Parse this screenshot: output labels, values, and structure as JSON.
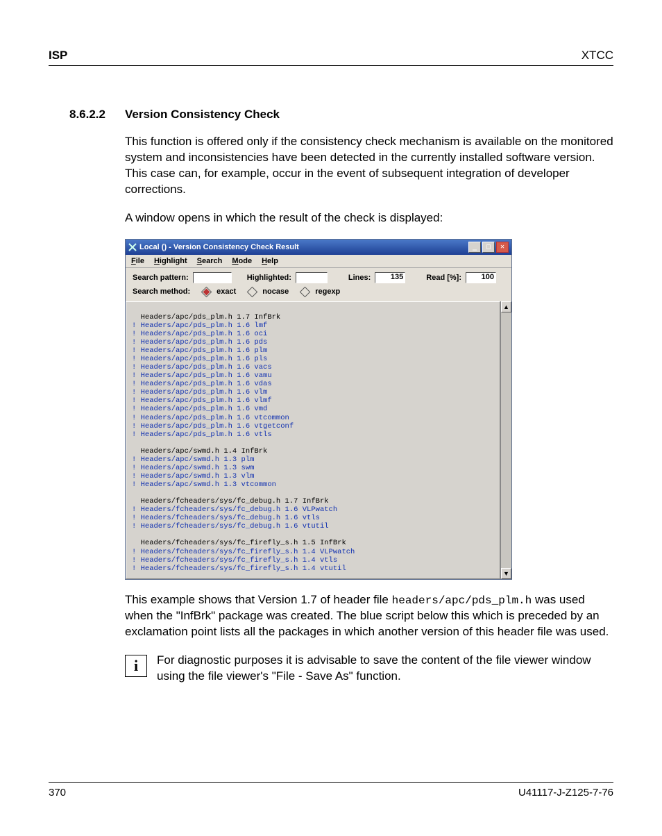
{
  "header": {
    "left": "ISP",
    "right": "XTCC"
  },
  "section": {
    "number": "8.6.2.2",
    "title": "Version Consistency Check"
  },
  "para1": "This function is offered only if the consistency check mechanism is available on the monitored system and inconsistencies have been detected in the currently installed software version. This case can, for example, occur in the event of subsequent integration of developer corrections.",
  "para2": "A window opens in which the result of the check is displayed:",
  "window": {
    "title": "Local () - Version Consistency Check Result",
    "menu": {
      "file": "File",
      "highlight": "Highlight",
      "search": "Search",
      "mode": "Mode",
      "help": "Help"
    },
    "labels": {
      "search_pattern": "Search pattern:",
      "highlighted": "Highlighted:",
      "lines": "Lines:",
      "read": "Read [%]:",
      "search_method": "Search method:",
      "exact": "exact",
      "nocase": "nocase",
      "regexp": "regexp"
    },
    "values": {
      "lines": "135",
      "read": "100"
    },
    "lines": [
      {
        "c": "blk",
        "t": "  Headers/apc/pds_plm.h 1.7 InfBrk"
      },
      {
        "c": "blu",
        "t": "! Headers/apc/pds_plm.h 1.6 lmf"
      },
      {
        "c": "blu",
        "t": "! Headers/apc/pds_plm.h 1.6 oci"
      },
      {
        "c": "blu",
        "t": "! Headers/apc/pds_plm.h 1.6 pds"
      },
      {
        "c": "blu",
        "t": "! Headers/apc/pds_plm.h 1.6 plm"
      },
      {
        "c": "blu",
        "t": "! Headers/apc/pds_plm.h 1.6 pls"
      },
      {
        "c": "blu",
        "t": "! Headers/apc/pds_plm.h 1.6 vacs"
      },
      {
        "c": "blu",
        "t": "! Headers/apc/pds_plm.h 1.6 vamu"
      },
      {
        "c": "blu",
        "t": "! Headers/apc/pds_plm.h 1.6 vdas"
      },
      {
        "c": "blu",
        "t": "! Headers/apc/pds_plm.h 1.6 vlm"
      },
      {
        "c": "blu",
        "t": "! Headers/apc/pds_plm.h 1.6 vlmf"
      },
      {
        "c": "blu",
        "t": "! Headers/apc/pds_plm.h 1.6 vmd"
      },
      {
        "c": "blu",
        "t": "! Headers/apc/pds_plm.h 1.6 vtcommon"
      },
      {
        "c": "blu",
        "t": "! Headers/apc/pds_plm.h 1.6 vtgetconf"
      },
      {
        "c": "blu",
        "t": "! Headers/apc/pds_plm.h 1.6 vtls"
      },
      {
        "c": "blk",
        "t": ""
      },
      {
        "c": "blk",
        "t": "  Headers/apc/swmd.h 1.4 InfBrk"
      },
      {
        "c": "blu",
        "t": "! Headers/apc/swmd.h 1.3 plm"
      },
      {
        "c": "blu",
        "t": "! Headers/apc/swmd.h 1.3 swm"
      },
      {
        "c": "blu",
        "t": "! Headers/apc/swmd.h 1.3 vlm"
      },
      {
        "c": "blu",
        "t": "! Headers/apc/swmd.h 1.3 vtcommon"
      },
      {
        "c": "blk",
        "t": ""
      },
      {
        "c": "blk",
        "t": "  Headers/fcheaders/sys/fc_debug.h 1.7 InfBrk"
      },
      {
        "c": "blu",
        "t": "! Headers/fcheaders/sys/fc_debug.h 1.6 VLPwatch"
      },
      {
        "c": "blu",
        "t": "! Headers/fcheaders/sys/fc_debug.h 1.6 vtls"
      },
      {
        "c": "blu",
        "t": "! Headers/fcheaders/sys/fc_debug.h 1.6 vtutil"
      },
      {
        "c": "blk",
        "t": ""
      },
      {
        "c": "blk",
        "t": "  Headers/fcheaders/sys/fc_firefly_s.h 1.5 InfBrk"
      },
      {
        "c": "blu",
        "t": "! Headers/fcheaders/sys/fc_firefly_s.h 1.4 VLPwatch"
      },
      {
        "c": "blu",
        "t": "! Headers/fcheaders/sys/fc_firefly_s.h 1.4 vtls"
      },
      {
        "c": "blu",
        "t": "! Headers/fcheaders/sys/fc_firefly_s.h 1.4 vtutil"
      }
    ]
  },
  "para3_a": "This example shows that Version 1.7 of header file ",
  "para3_code": "headers/apc/pds_plm.h",
  "para3_b": " was used when the \"InfBrk\" package was created. The blue script below this which is preceded by an exclamation point lists all the packages in which another version of this header file was used.",
  "info_text": "For diagnostic purposes it is advisable to save the content of the file viewer window using the file viewer's \"File - Save As\" function.",
  "footer": {
    "page": "370",
    "docid": "U41117-J-Z125-7-76"
  }
}
